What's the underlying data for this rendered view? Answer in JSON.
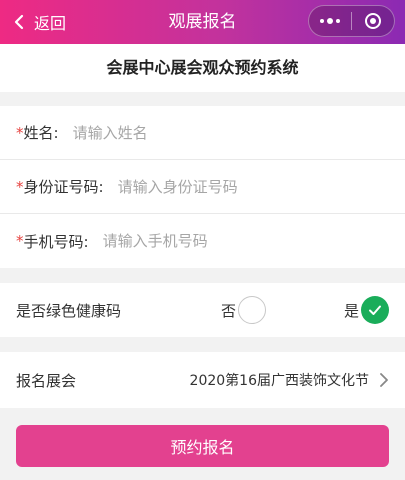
{
  "navbar": {
    "back_label": "返回",
    "title": "观展报名",
    "more_icon": "more-dots-icon",
    "close_icon": "mini-program-close-icon",
    "gradient": [
      "#ee2a83",
      "#8b2ab3"
    ]
  },
  "header": {
    "title": "会展中心展会观众预约系统"
  },
  "form": {
    "required_mark": "*",
    "fields": [
      {
        "label": "姓名:",
        "placeholder": "请输入姓名",
        "value": ""
      },
      {
        "label": "身份证号码:",
        "placeholder": "请输入身份证号码",
        "value": ""
      },
      {
        "label": "手机号码:",
        "placeholder": "请输入手机号码",
        "value": ""
      }
    ]
  },
  "health_code": {
    "label": "是否绿色健康码",
    "options": [
      {
        "label": "否",
        "selected": false
      },
      {
        "label": "是",
        "selected": true
      }
    ],
    "selected_color": "#1aad5a"
  },
  "exhibition": {
    "label": "报名展会",
    "value": "2020第16届广西装饰文化节",
    "arrow_icon": "chevron-right-icon"
  },
  "submit": {
    "label": "预约报名",
    "color": "#e3418f"
  }
}
